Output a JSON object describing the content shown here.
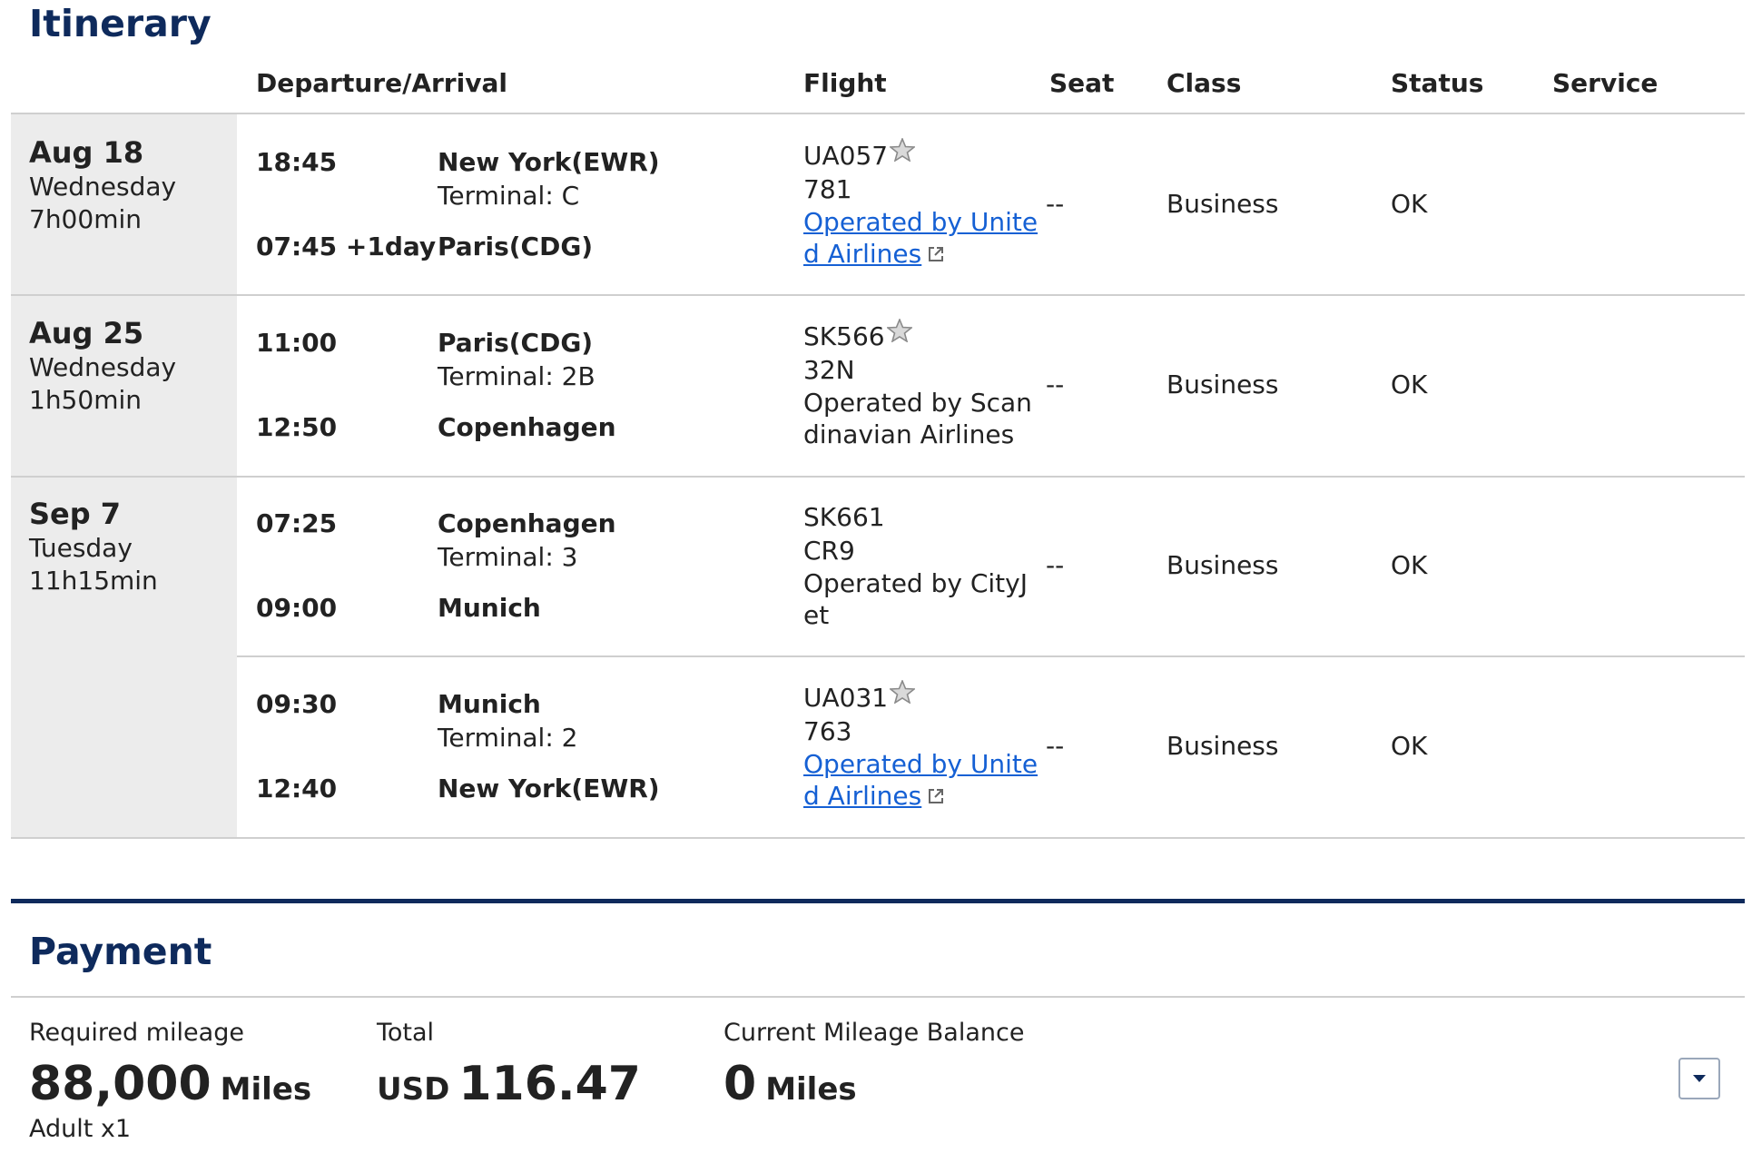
{
  "itinerary": {
    "title": "Itinerary",
    "headers": {
      "dep_arr": "Departure/Arrival",
      "flight": "Flight",
      "seat": "Seat",
      "class": "Class",
      "status": "Status",
      "service": "Service"
    },
    "days": [
      {
        "date": "Aug 18",
        "weekday": "Wednesday",
        "duration": "7h00min"
      },
      {
        "date": "Aug 25",
        "weekday": "Wednesday",
        "duration": "1h50min"
      },
      {
        "date": "Sep 7",
        "weekday": "Tuesday",
        "duration": "11h15min"
      }
    ],
    "segments": [
      {
        "dep_time": "18:45",
        "dep_city": "New York(EWR)",
        "dep_terminal": "Terminal: C",
        "arr_time": "07:45 +1day",
        "arr_city": "Paris(CDG)",
        "flight_no": "UA057",
        "aircraft": "781",
        "operated_1": "Operated by Unite",
        "operated_2": "d Airlines",
        "operated_is_link": true,
        "star_alliance": true,
        "seat": "--",
        "class": "Business",
        "status": "OK",
        "service": ""
      },
      {
        "dep_time": "11:00",
        "dep_city": "Paris(CDG)",
        "dep_terminal": "Terminal: 2B",
        "arr_time": "12:50",
        "arr_city": "Copenhagen",
        "flight_no": "SK566",
        "aircraft": "32N",
        "operated_1": "Operated by Scan",
        "operated_2": "dinavian Airlines",
        "operated_is_link": false,
        "star_alliance": true,
        "seat": "--",
        "class": "Business",
        "status": "OK",
        "service": ""
      },
      {
        "dep_time": "07:25",
        "dep_city": "Copenhagen",
        "dep_terminal": "Terminal: 3",
        "arr_time": "09:00",
        "arr_city": "Munich",
        "flight_no": "SK661",
        "aircraft": "CR9",
        "operated_1": "Operated by CityJ",
        "operated_2": "et",
        "operated_is_link": false,
        "star_alliance": false,
        "seat": "--",
        "class": "Business",
        "status": "OK",
        "service": ""
      },
      {
        "dep_time": "09:30",
        "dep_city": "Munich",
        "dep_terminal": "Terminal: 2",
        "arr_time": "12:40",
        "arr_city": "New York(EWR)",
        "flight_no": "UA031",
        "aircraft": "763",
        "operated_1": "Operated by Unite",
        "operated_2": "d Airlines",
        "operated_is_link": true,
        "star_alliance": true,
        "seat": "--",
        "class": "Business",
        "status": "OK",
        "service": ""
      }
    ]
  },
  "payment": {
    "title": "Payment",
    "required_mileage_label": "Required mileage",
    "required_mileage_value": "88,000",
    "required_mileage_unit": "Miles",
    "passengers": "Adult x1",
    "total_label": "Total",
    "total_currency": "USD",
    "total_value": "116.47",
    "balance_label": "Current Mileage Balance",
    "balance_value": "0",
    "balance_unit": "Miles"
  },
  "icons": {
    "star_alliance": "star-alliance-icon",
    "external_link": "external-link-icon",
    "dropdown": "chevron-down-icon"
  },
  "colors": {
    "title_navy": "#0e2a5c",
    "link_blue": "#1560d4",
    "date_bg": "#ececec"
  }
}
